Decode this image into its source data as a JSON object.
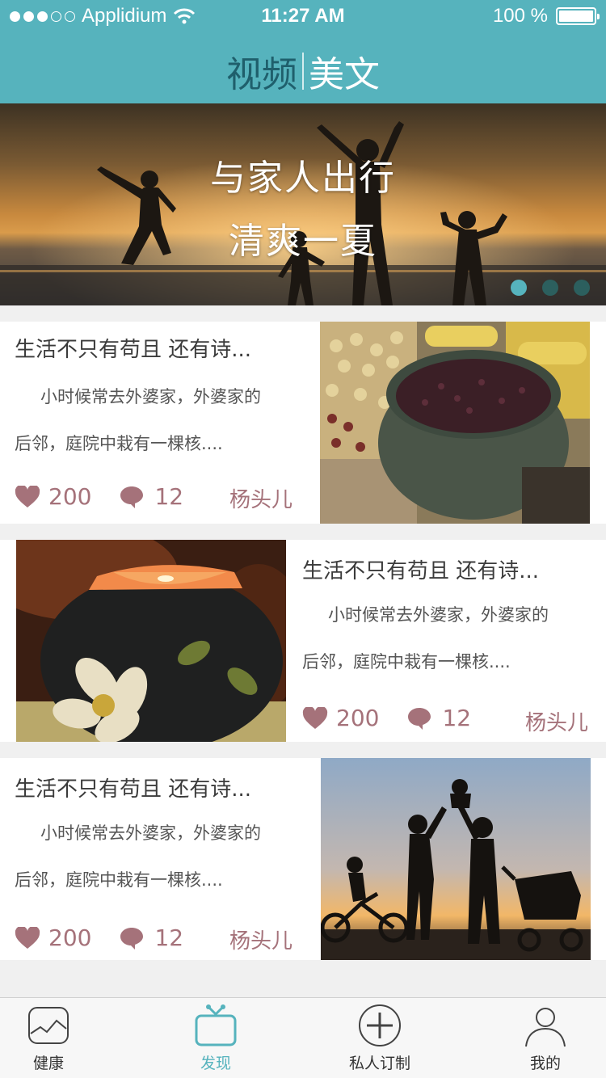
{
  "status_bar": {
    "carrier": "Applidium",
    "time": "11:27 AM",
    "battery": "100 %"
  },
  "header": {
    "tab_video": "视频",
    "tab_article": "美文"
  },
  "banner": {
    "line1": "与家人出行",
    "line2": "清爽一夏",
    "pages": 3,
    "active_page": 1
  },
  "articles": [
    {
      "title": "生活不只有苟且 还有诗...",
      "excerpt_line1": "小时候常去外婆家，外婆家的",
      "excerpt_line2": "后邻，庭院中栽有一棵核....",
      "likes": "200",
      "comments": "12",
      "author": "杨头儿",
      "image": "bowl-of-grains"
    },
    {
      "title": "生活不只有苟且 还有诗...",
      "excerpt_line1": "小时候常去外婆家，外婆家的",
      "excerpt_line2": "后邻，庭院中栽有一棵核....",
      "likes": "200",
      "comments": "12",
      "author": "杨头儿",
      "image": "candle-holder"
    },
    {
      "title": "生活不只有苟且 还有诗...",
      "excerpt_line1": "小时候常去外婆家，外婆家的",
      "excerpt_line2": "后邻，庭院中栽有一棵核....",
      "likes": "200",
      "comments": "12",
      "author": "杨头儿",
      "image": "family-silhouette"
    }
  ],
  "tabbar": {
    "health": "健康",
    "discover": "发现",
    "custom": "私人订制",
    "mine": "我的",
    "active": "discover"
  },
  "colors": {
    "accent": "#56b3bd",
    "meta": "#a5727a"
  }
}
